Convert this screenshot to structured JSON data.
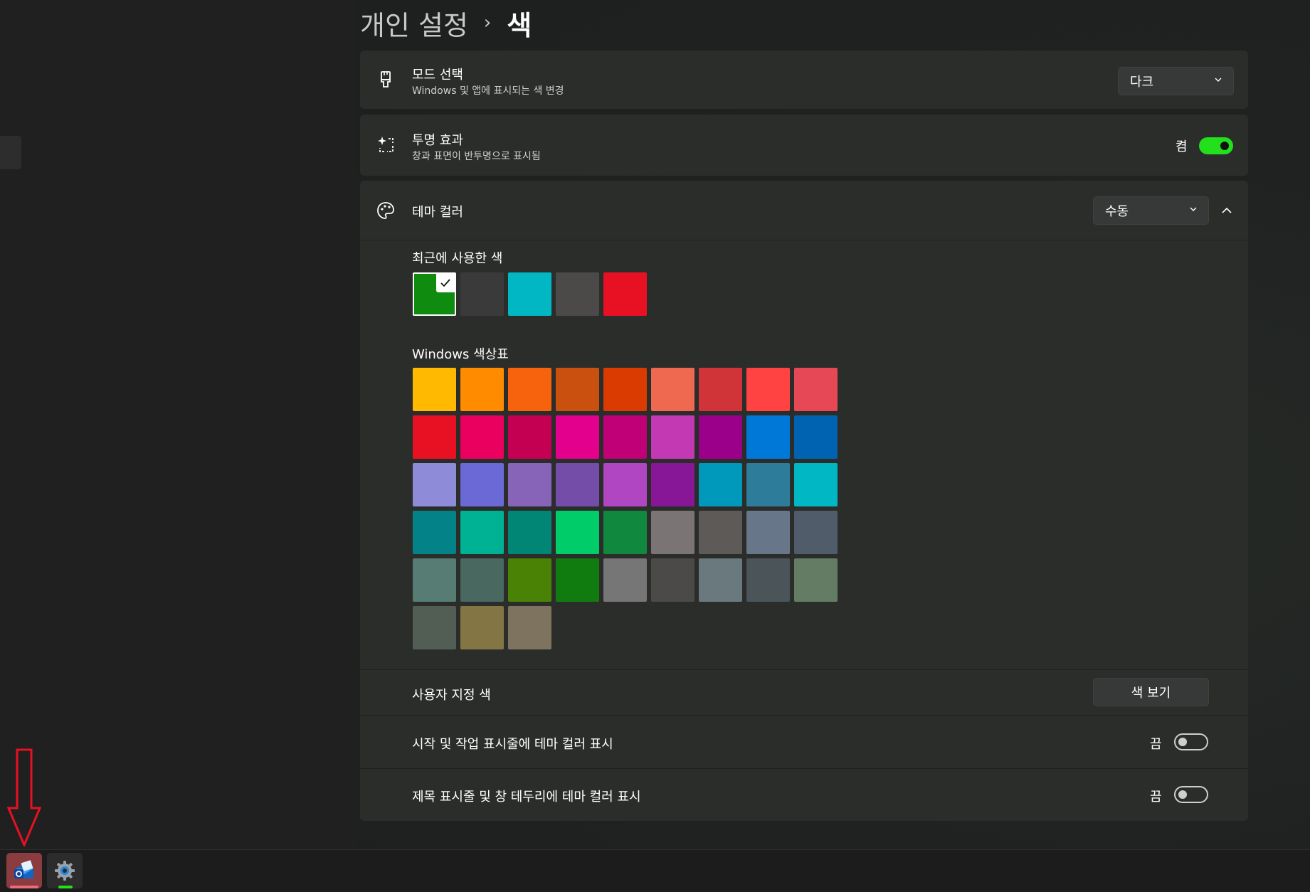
{
  "breadcrumb": {
    "parent": "개인 설정",
    "separator": "›",
    "current": "색"
  },
  "mode": {
    "title": "모드 선택",
    "subtitle": "Windows 및 앱에 표시되는 색 변경",
    "value": "다크",
    "icon": "brush-icon"
  },
  "transparency": {
    "title": "투명 효과",
    "subtitle": "창과 표면이 반투명으로 표시됨",
    "state_label": "켬",
    "on": true,
    "icon": "transparency-sparkle-icon"
  },
  "theme_color": {
    "title": "테마 컬러",
    "value": "수동",
    "icon": "palette-icon",
    "recent_label": "최근에 사용한 색",
    "recent_colors": [
      "#0f8c0f",
      "#3a3a3a",
      "#00b7c3",
      "#4c4a48",
      "#e81123"
    ],
    "recent_selected_index": 0,
    "palette_label": "Windows 색상표",
    "palette_colors": [
      "#ffb900",
      "#ff8c00",
      "#f7630c",
      "#ca5010",
      "#da3b01",
      "#ef6950",
      "#d13438",
      "#ff4343",
      "#e74856",
      "#e81123",
      "#ea005e",
      "#c30052",
      "#e3008c",
      "#bf0077",
      "#c239b3",
      "#9a0089",
      "#0078d7",
      "#0063b1",
      "#8e8cd8",
      "#6b69d6",
      "#8764b8",
      "#744da9",
      "#b146c2",
      "#881798",
      "#0099bc",
      "#2d7d9a",
      "#00b7c3",
      "#038387",
      "#00b294",
      "#018574",
      "#00cc6a",
      "#10893e",
      "#7a7574",
      "#5d5a58",
      "#68768a",
      "#515c6b",
      "#567c73",
      "#486860",
      "#498205",
      "#107c10",
      "#767676",
      "#4c4a48",
      "#69797e",
      "#4a5459",
      "#647c64",
      "#525e54",
      "#847545",
      "#7e735f"
    ]
  },
  "custom_color": {
    "label": "사용자 지정 색",
    "button": "색 보기"
  },
  "start_taskbar": {
    "label": "시작 및 작업 표시줄에 테마 컬러 표시",
    "state_label": "끔",
    "on": false
  },
  "title_bars": {
    "label": "제목 표시줄 및 창 테두리에 테마 컬러 표시",
    "state_label": "끔",
    "on": false
  },
  "taskbar": {
    "items": [
      {
        "icon": "outlook-mail-icon",
        "active": true
      },
      {
        "icon": "settings-gear-icon",
        "active": false
      }
    ]
  },
  "accent_colors": {
    "toggle_on": "#22e01c",
    "annotation_arrow": "#e81123"
  }
}
